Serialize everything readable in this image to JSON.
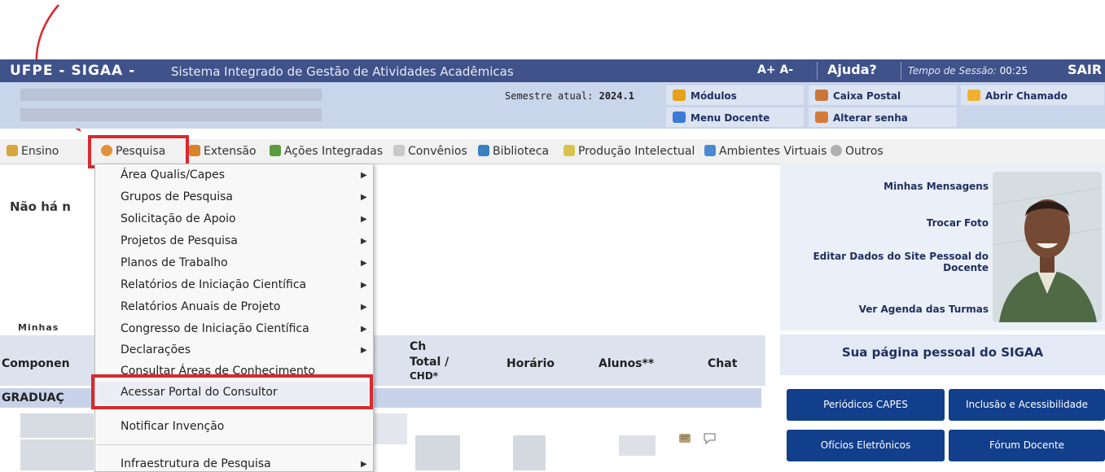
{
  "titlebar": {
    "system": "UFPE - SIGAA -",
    "description": "Sistema Integrado de Gestão de Atividades Acadêmicas",
    "font_controls": "A+ A-",
    "help": "Ajuda?",
    "session_label": "Tempo de Sessão:",
    "session_time": "00:25",
    "logout": "SAIR"
  },
  "infobar": {
    "semester_label": "Semestre atual:",
    "semester_value": "2024.1",
    "modules": "Módulos",
    "mailbox": "Caixa Postal",
    "open_ticket": "Abrir Chamado",
    "teacher_menu": "Menu Docente",
    "change_password": "Alterar senha"
  },
  "menubar": {
    "items": [
      "Ensino",
      "Pesquisa",
      "Extensão",
      "Ações Integradas",
      "Convênios",
      "Biblioteca",
      "Produção Intelectual",
      "Ambientes Virtuais",
      "Outros"
    ]
  },
  "dropdown": {
    "items": [
      "Área Qualis/Capes",
      "Grupos de Pesquisa",
      "Solicitação de Apoio",
      "Projetos de Pesquisa",
      "Planos de Trabalho",
      "Relatórios de Iniciação Científica",
      "Relatórios Anuais de Projeto",
      "Congresso de Iniciação Científica",
      "Declarações",
      "Consultar Áreas de Conhecimento",
      "Acessar Portal do Consultor",
      "Notificar Invenção",
      "Infraestrutura de Pesquisa"
    ]
  },
  "main": {
    "no_items_text": "Não há n",
    "my_label": "Minhas",
    "columns": {
      "component": "Componen",
      "ch": "Ch",
      "total_chd": "Total /",
      "chd": "CHD*",
      "schedule": "Horário",
      "students": "Alunos**",
      "chat": "Chat"
    },
    "section": "GRADUAÇ"
  },
  "right_panel": {
    "messages": "Minhas Mensagens",
    "change_photo": "Trocar Foto",
    "edit_site_1": "Editar Dados do Site Pessoal do",
    "edit_site_2": "Docente",
    "schedule": "Ver Agenda das Turmas",
    "personal_page": "Sua página pessoal do SIGAA",
    "buttons": [
      "Periódicos CAPES",
      "Inclusão e Acessibilidade",
      "Ofícios Eletrônicos",
      "Fórum Docente"
    ]
  },
  "colors": {
    "title_bar": "#40528a",
    "highlight": "#d9282f",
    "button_blue": "#123f8c"
  }
}
